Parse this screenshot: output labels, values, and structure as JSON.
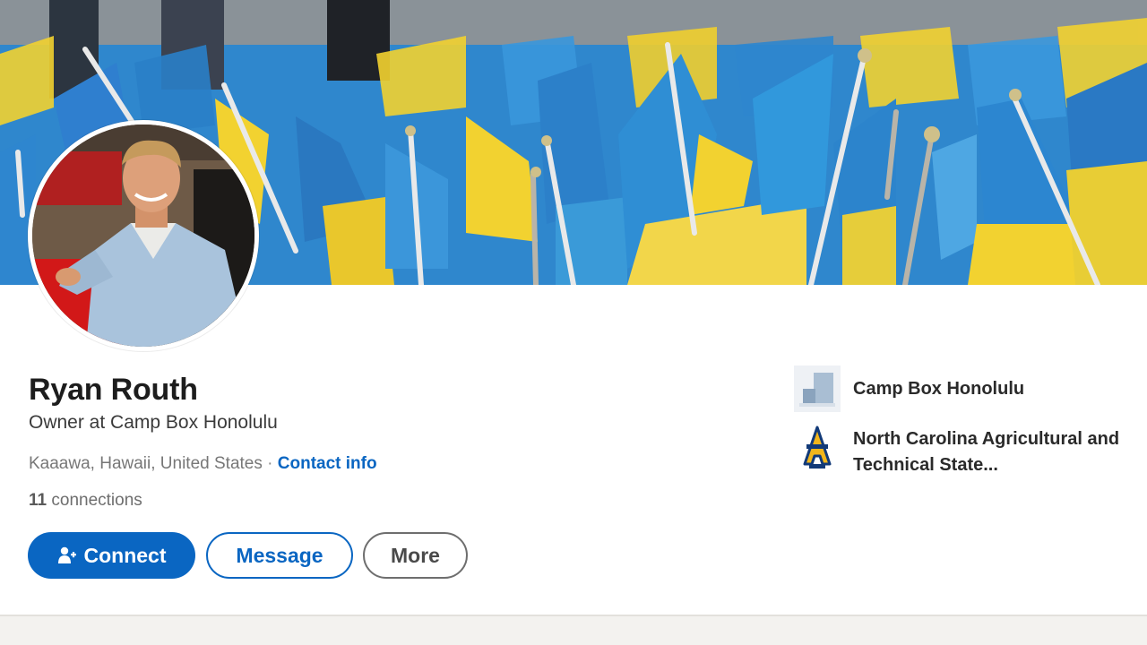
{
  "profile": {
    "name": "Ryan Routh",
    "headline": "Owner at Camp Box Honolulu",
    "location": "Kaaawa, Hawaii, United States",
    "location_separator": "·",
    "contact_info_label": "Contact info",
    "connections_count": "11",
    "connections_label": "connections"
  },
  "actions": {
    "connect_label": "Connect",
    "message_label": "Message",
    "more_label": "More"
  },
  "organizations": [
    {
      "name": "Camp Box Honolulu",
      "logo_icon": "company-placeholder-icon"
    },
    {
      "name": "North Carolina Agricultural and Technical State...",
      "logo_icon": "aggies-logo-icon"
    }
  ],
  "colors": {
    "accent": "#0a66c2",
    "flag_blue": "#2f8fd6",
    "flag_yellow": "#f2d230"
  }
}
